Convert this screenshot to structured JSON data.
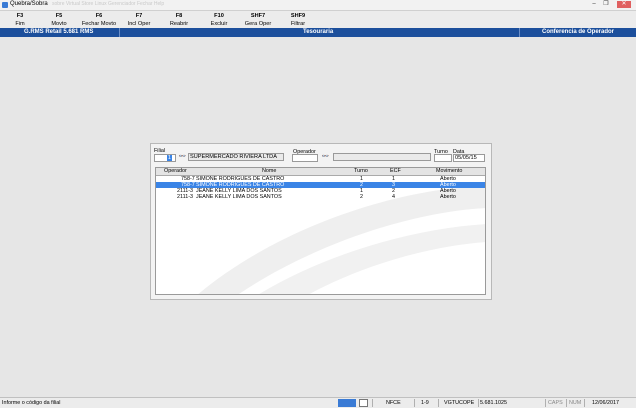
{
  "window": {
    "title": "Quebra/Sobra",
    "ghost_text": "sobre Virtual Store  Linux  Gerenciador  Fechar  Help"
  },
  "toolbar": [
    {
      "key": "F3",
      "label": "Fim"
    },
    {
      "key": "F5",
      "label": "Movto"
    },
    {
      "key": "F6",
      "label": "Fechar Movto"
    },
    {
      "key": "F7",
      "label": "Incl Oper"
    },
    {
      "key": "F8",
      "label": "Reabrir"
    },
    {
      "key": "F10",
      "label": "Excluir"
    },
    {
      "key": "SHF7",
      "label": "Gera Oper"
    },
    {
      "key": "SHF9",
      "label": "Filtrar"
    }
  ],
  "header_bar": {
    "left": "G.RMS Retail 5.681 RMS",
    "center": "Tesouraria",
    "right": "Conferencia de Operador"
  },
  "form": {
    "filial_label": "Filial",
    "filial_value": "1",
    "filial_name": "SUPERMERCADO RIVIERA LTDA",
    "operador_label": "Operador",
    "operador_value": "",
    "operador_name": "",
    "turno_label": "Turno",
    "turno_value": "",
    "data_label": "Data",
    "data_value": "05/05/15"
  },
  "grid": {
    "columns": [
      "Operador",
      "Nome",
      "Turno",
      "ECF",
      "Movimento"
    ],
    "rows": [
      {
        "operador": "758-7",
        "nome": "SIMONE RODRIGUES DE CASTRO",
        "turno": "1",
        "ecf": "1",
        "movimento": "Aberto",
        "selected": false
      },
      {
        "operador": "758-7",
        "nome": "SIMONE RODRIGUES DE CASTRO",
        "turno": "2",
        "ecf": "3",
        "movimento": "Aberto",
        "selected": true
      },
      {
        "operador": "2111-3",
        "nome": "JEANE KELLY LIMA DOS SANTOS",
        "turno": "1",
        "ecf": "2",
        "movimento": "Aberto",
        "selected": false
      },
      {
        "operador": "2111-3",
        "nome": "JEANE KELLY LIMA DOS SANTOS",
        "turno": "2",
        "ecf": "4",
        "movimento": "Aberto",
        "selected": false
      }
    ]
  },
  "status": {
    "message": "Informe o código da filial",
    "nfce": "NFCE",
    "page": "1-9",
    "db": "VGTUCOPE",
    "version": "5.681.1025",
    "caps": "CAPS",
    "num": "NUM",
    "date": "12/06/2017"
  }
}
